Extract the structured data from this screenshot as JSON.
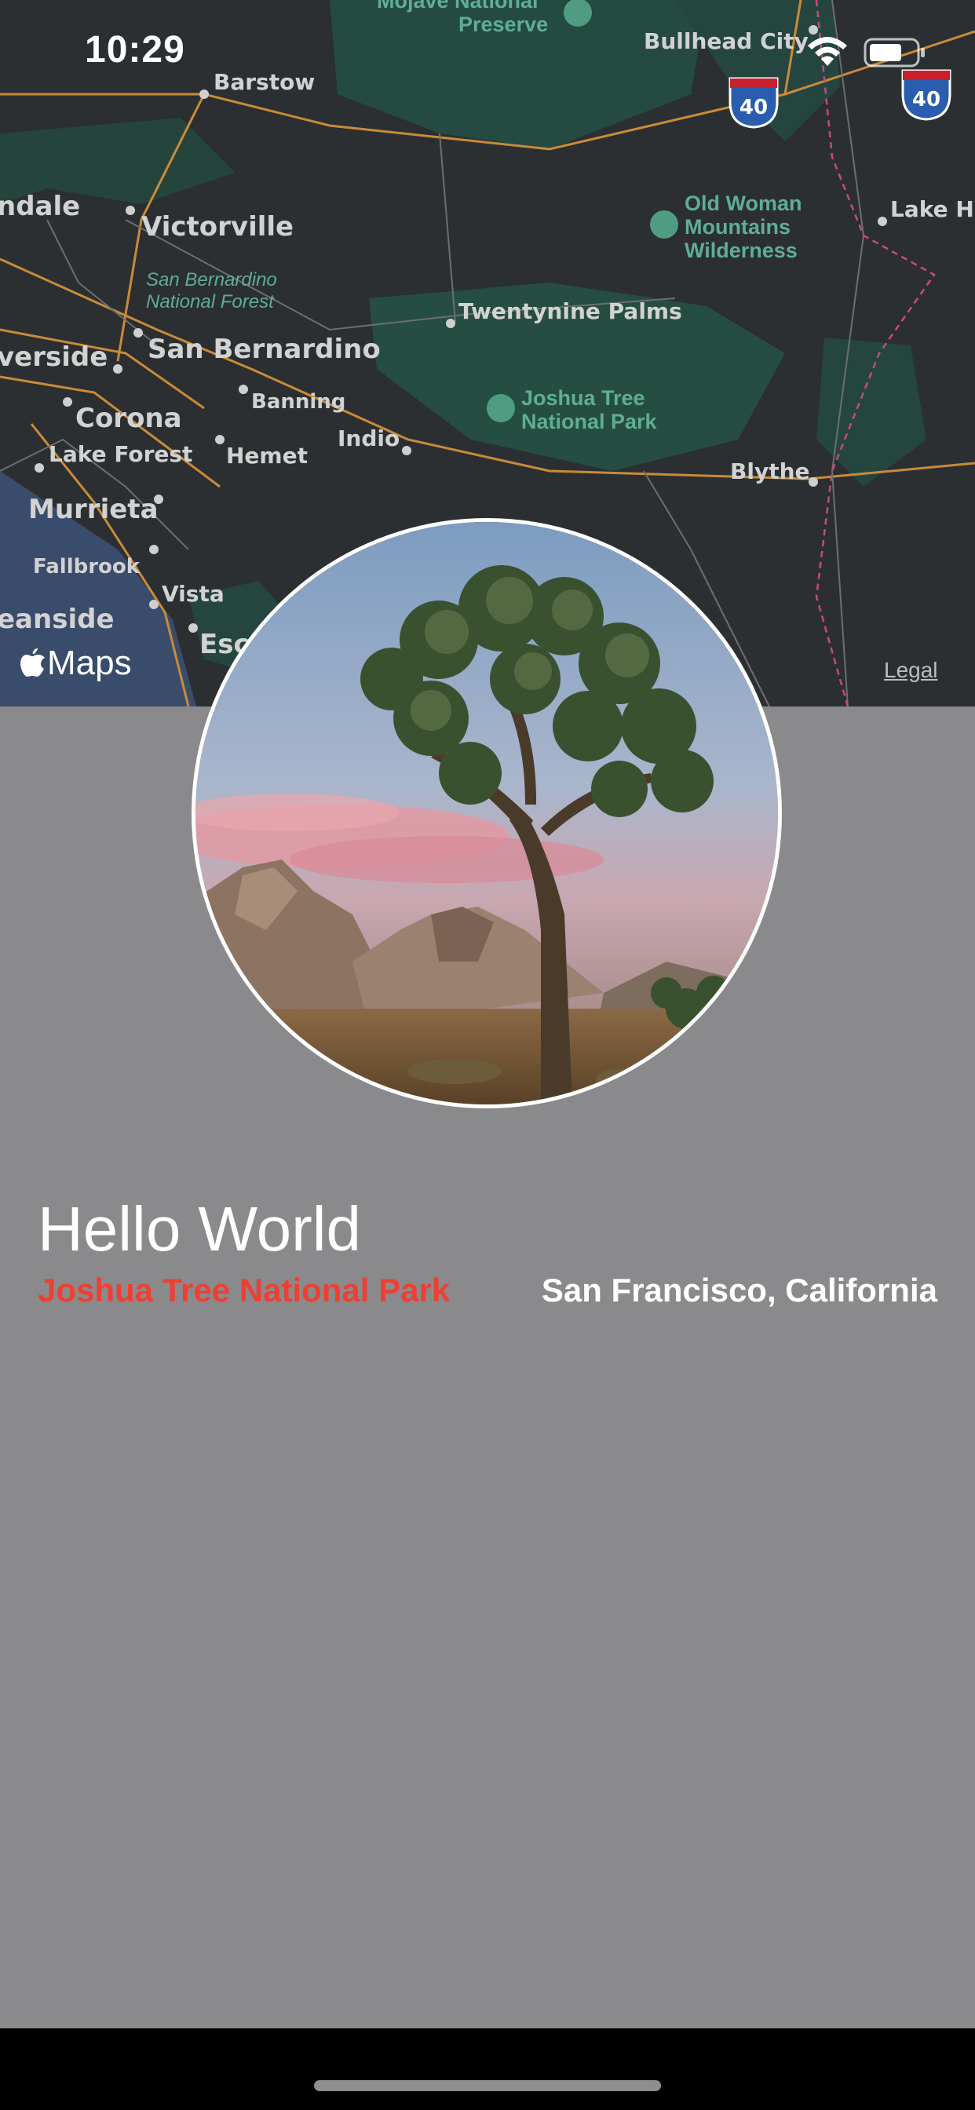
{
  "status_bar": {
    "time": "10:29"
  },
  "map": {
    "brand": "Maps",
    "legal": "Legal",
    "labels": {
      "mojave": "Mojave National",
      "preserve": "Preserve",
      "barstow": "Barstow",
      "bullhead": "Bullhead City",
      "i40a": "40",
      "i40b": "40",
      "ndale": "ndale",
      "victorville": "Victorville",
      "old_woman_1": "Old Woman",
      "old_woman_2": "Mountains",
      "old_woman_3": "Wilderness",
      "lake_ha": "Lake Ha",
      "sb_forest_1": "San Bernardino",
      "sb_forest_2": "National Forest",
      "twentynine": "Twentynine Palms",
      "verside": "verside",
      "san_bernardino": "San Bernardino",
      "banning": "Banning",
      "corona": "Corona",
      "jt_1": "Joshua Tree",
      "jt_2": "National Park",
      "indio": "Indio",
      "lake_forest": "Lake Forest",
      "hemet": "Hemet",
      "blythe": "Blythe",
      "murrieta": "Murrieta",
      "fallbrook": "Fallbrook",
      "vista": "Vista",
      "eanside": "eanside",
      "esc": "Esc"
    }
  },
  "content": {
    "title": "Hello World",
    "park": "Joshua Tree National Park",
    "location": "San Francisco, California"
  },
  "colors": {
    "background": "#8a8a8c",
    "park_text": "#ef3f32",
    "map_bg": "#2b2f31"
  }
}
